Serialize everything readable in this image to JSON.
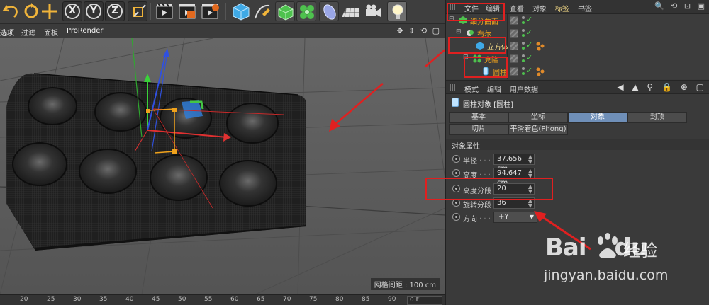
{
  "toolbar": {
    "tools": [
      "undo-icon",
      "redo-icon",
      "move-icon"
    ],
    "axis_x": "X",
    "axis_y": "Y",
    "axis_z": "Z",
    "icons": [
      "coordinate-system-icon",
      "render-view-icon",
      "render-picture-viewer-icon",
      "render-settings-icon",
      "cube-primitive-icon",
      "pen-spline-icon",
      "subdivision-surface-icon",
      "cloner-icon",
      "deformer-icon",
      "floor-icon",
      "camera-icon",
      "light-icon"
    ]
  },
  "viewport": {
    "menu": [
      "选项",
      "过滤",
      "面板",
      "ProRender"
    ],
    "nav_icons": "✥ ⇕ ⟲ ▢",
    "grid_label": "网格间距 : 100 cm"
  },
  "timeline": {
    "ticks": [
      "20",
      "25",
      "30",
      "35",
      "40",
      "45",
      "50",
      "55",
      "60",
      "65",
      "70",
      "75",
      "80",
      "85",
      "90"
    ],
    "frame": "0 F"
  },
  "object_manager": {
    "menu": [
      "文件",
      "编辑",
      "查看",
      "对象",
      "标签",
      "书签"
    ],
    "active_menu": "标签",
    "header_icons": "🔍 ⟲ ⊡ ▣",
    "objects": [
      {
        "name": "细分曲面",
        "color": "#f0a21c"
      },
      {
        "name": "布尔",
        "color": "#f0a21c"
      },
      {
        "name": "立方体",
        "color": "#ffe38a"
      },
      {
        "name": "克隆",
        "color": "#f0a21c"
      },
      {
        "name": "圆柱",
        "color": "#f0a21c"
      }
    ]
  },
  "attribute_manager": {
    "menu": [
      "模式",
      "编辑",
      "用户数据"
    ],
    "tools": "◀ ▲ ⚲ 🔒 ⊕ ▢",
    "title": "圆柱对象 [圆柱]",
    "tabs_row1": [
      "基本",
      "坐标",
      "对象",
      "封顶"
    ],
    "tabs_row2": [
      "切片",
      "平滑着色(Phong)"
    ],
    "active_tab": "对象",
    "section": "对象属性",
    "properties": [
      {
        "label": "半径",
        "dots": ". . .",
        "value": "37.656 cm"
      },
      {
        "label": "高度",
        "dots": ". . .",
        "value": "94.647 cm"
      },
      {
        "label": "高度分段",
        "dots": "",
        "value": "20"
      },
      {
        "label": "旋转分段",
        "dots": "",
        "value": "36"
      },
      {
        "label": "方向",
        "dots": ". . .",
        "value": "+Y"
      }
    ]
  },
  "watermark": {
    "brand": "Bai",
    "brand_tail": "du",
    "cn": "经验",
    "url": "jingyan.baidu.com"
  },
  "colors": {
    "highlight": "#e02020",
    "accent_yellow": "#ffe38a",
    "object_orange": "#f0a21c",
    "active_tab": "#6f8fb8"
  }
}
